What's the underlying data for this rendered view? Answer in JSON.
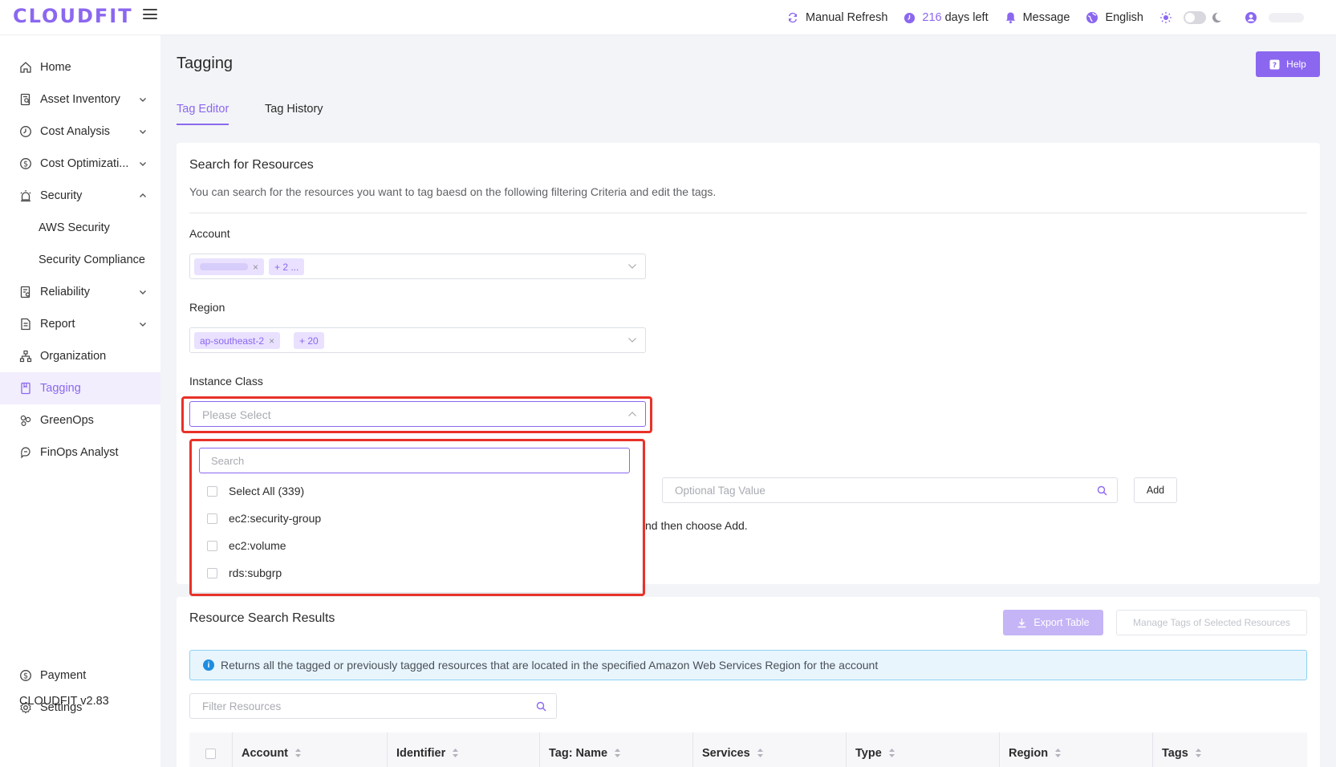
{
  "app": {
    "logo": "CLOUDFIT",
    "version": "CLOUDFIT v2.83"
  },
  "header": {
    "manual_refresh": "Manual Refresh",
    "days_left_number": "216",
    "days_left_label": "days left",
    "message": "Message",
    "language": "English"
  },
  "sidebar": {
    "items": [
      {
        "label": "Home",
        "icon": "home-icon"
      },
      {
        "label": "Asset Inventory",
        "icon": "inventory-icon"
      },
      {
        "label": "Cost Analysis",
        "icon": "clock-icon"
      },
      {
        "label": "Cost Optimizati...",
        "icon": "dollar-icon"
      },
      {
        "label": "Security",
        "icon": "alarm-icon"
      },
      {
        "label": "AWS Security"
      },
      {
        "label": "Security Compliance"
      },
      {
        "label": "Reliability",
        "icon": "document-check-icon"
      },
      {
        "label": "Report",
        "icon": "report-icon"
      },
      {
        "label": "Organization",
        "icon": "organization-icon"
      },
      {
        "label": "Tagging",
        "icon": "tag-icon"
      },
      {
        "label": "GreenOps",
        "icon": "greenops-icon"
      },
      {
        "label": "FinOps Analyst",
        "icon": "analyst-icon"
      }
    ],
    "payment": "Payment",
    "settings": "Settings"
  },
  "page": {
    "title": "Tagging",
    "help": "Help",
    "tabs": [
      {
        "label": "Tag Editor"
      },
      {
        "label": "Tag History"
      }
    ]
  },
  "search": {
    "title": "Search for Resources",
    "description": "You can search for the resources you want to tag baesd on the following filtering Criteria and edit the tags.",
    "account_label": "Account",
    "account_more": "+ 2 ...",
    "region_label": "Region",
    "region_chip": "ap-southeast-2",
    "region_more": "+ 20",
    "instance_label": "Instance Class",
    "instance_placeholder": "Please Select",
    "dropdown_search_placeholder": "Search",
    "dropdown_options": [
      "Select All (339)",
      "ec2:security-group",
      "ec2:volume",
      "rds:subgrp"
    ],
    "tag_value_placeholder": "Optional Tag Value",
    "add": "Add",
    "hint_fragment": "nd then choose Add."
  },
  "results": {
    "title": "Resource Search Results",
    "export": "Export Table",
    "manage": "Manage Tags of Selected Resources",
    "info": "Returns all the tagged or previously tagged resources that are located in the specified Amazon Web Services Region for the account",
    "filter_placeholder": "Filter Resources",
    "columns": [
      "Account",
      "Identifier",
      "Tag: Name",
      "Services",
      "Type",
      "Region",
      "Tags"
    ]
  },
  "colors": {
    "accent": "#8b67f0",
    "highlight": "#e83228",
    "info_border": "#8fd0f2"
  }
}
